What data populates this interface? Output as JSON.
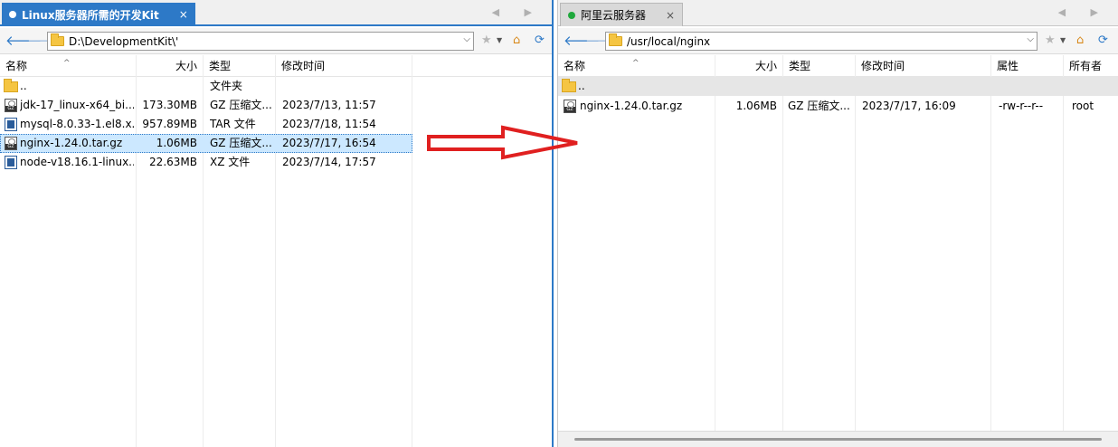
{
  "left": {
    "tab": {
      "title": "Linux服务器所需的开发Kit",
      "close": "×"
    },
    "tab_arrows": "◀ ▶",
    "address": "D:\\DevelopmentKit\\'",
    "headers": {
      "name": "名称",
      "size": "大小",
      "type": "类型",
      "modified": "修改时间"
    },
    "rows": [
      {
        "name": "..",
        "size": "",
        "type": "文件夹",
        "modified": ""
      },
      {
        "name": "jdk-17_linux-x64_bi...",
        "size": "173.30MB",
        "type": "GZ 压缩文...",
        "modified": "2023/7/13, 11:57"
      },
      {
        "name": "mysql-8.0.33-1.el8.x...",
        "size": "957.89MB",
        "type": "TAR 文件",
        "modified": "2023/7/18, 11:54"
      },
      {
        "name": "nginx-1.24.0.tar.gz",
        "size": "1.06MB",
        "type": "GZ 压缩文...",
        "modified": "2023/7/17, 16:54"
      },
      {
        "name": "node-v18.16.1-linux...",
        "size": "22.63MB",
        "type": "XZ 文件",
        "modified": "2023/7/14, 17:57"
      }
    ]
  },
  "right": {
    "tab": {
      "title": "阿里云服务器",
      "close": "×"
    },
    "tab_arrows": "◀ ▶",
    "address": "/usr/local/nginx",
    "headers": {
      "name": "名称",
      "size": "大小",
      "type": "类型",
      "modified": "修改时间",
      "attrs": "属性",
      "owner": "所有者"
    },
    "rows": [
      {
        "name": "..",
        "size": "",
        "type": "",
        "modified": "",
        "attrs": "",
        "owner": ""
      },
      {
        "name": "nginx-1.24.0.tar.gz",
        "size": "1.06MB",
        "type": "GZ 压缩文...",
        "modified": "2023/7/17, 16:09",
        "attrs": "-rw-r--r--",
        "owner": "root"
      }
    ]
  },
  "icons": {
    "back": "arrow-left-icon",
    "forward": "arrow-right-icon",
    "star": "star-icon",
    "home": "home-folder-icon",
    "refresh": "refresh-icon",
    "dropdown": "chevron-down-icon"
  },
  "colors": {
    "accent": "#2d79c7",
    "arrow": "#e02020",
    "selected_row": "#cce8ff"
  }
}
